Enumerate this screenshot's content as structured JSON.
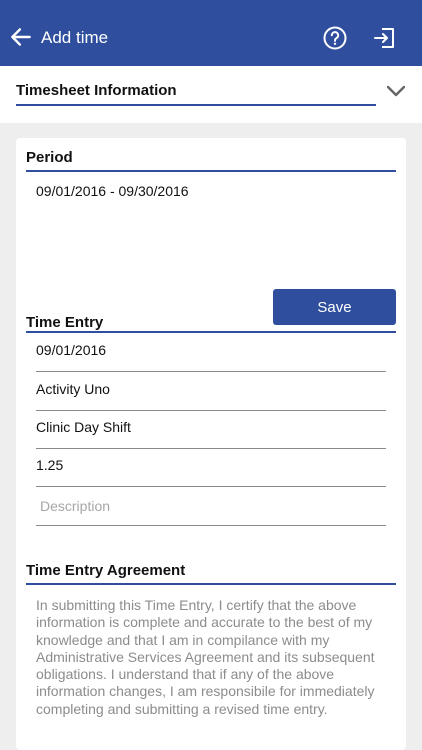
{
  "appbar": {
    "title": "Add time",
    "back_icon": "arrow-left-icon",
    "help_icon": "help-circle-icon",
    "exit_icon": "exit-icon"
  },
  "timesheet_section": {
    "label": "Timesheet Information",
    "chevron_icon": "chevron-down-icon"
  },
  "period": {
    "heading": "Period",
    "value": "09/01/2016 - 09/30/2016"
  },
  "save_label": "Save",
  "time_entry": {
    "heading": "Time Entry",
    "date": "09/01/2016",
    "activity": "Activity Uno",
    "shift": "Clinic Day Shift",
    "hours": "1.25",
    "description_placeholder": "Description",
    "description_value": ""
  },
  "agreement": {
    "heading": "Time Entry Agreement",
    "text": "In submitting this Time Entry, I certify that the above information is complete and accurate to the best of my knowledge and that I am in compilance with my Administrative Services Agreement and its subsequent obligations. I understand that if any of the above information changes, I am responsibile for immediately completing and submitting a revised time entry."
  },
  "colors": {
    "primary": "#2f4f9e",
    "background": "#eeeeee",
    "muted_text": "#8c8c8c"
  }
}
